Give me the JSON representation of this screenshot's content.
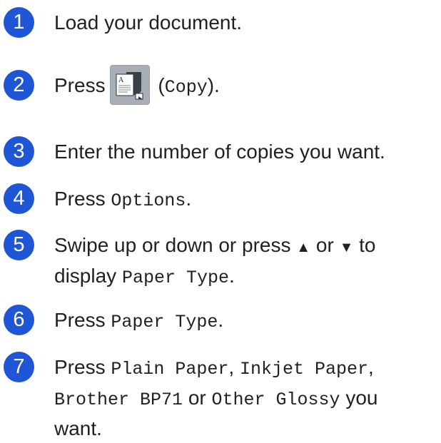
{
  "steps": [
    {
      "number": "1",
      "text": "Load your document."
    },
    {
      "number": "2",
      "press": "Press",
      "paren_open": " (",
      "copy_label": "Copy",
      "paren_close": ").",
      "icon": "copy-icon"
    },
    {
      "number": "3",
      "text": "Enter the number of copies you want."
    },
    {
      "number": "4",
      "press": "Press",
      "options": "Options",
      "end": "."
    },
    {
      "number": "5",
      "line1_a": "Swipe up or down or press",
      "up_arrow": "▲",
      "or": "or",
      "down_arrow": "▼",
      "line1_b": "to",
      "display": "display",
      "paper_type": "Paper Type",
      "end": "."
    },
    {
      "number": "6",
      "press": "Press",
      "paper_type": "Paper Type",
      "end": "."
    },
    {
      "number": "7",
      "press": "Press",
      "plain": "Plain Paper",
      "comma1": ",",
      "inkjet": "Inkjet Paper",
      "comma2": ",",
      "brother": "Brother BP71",
      "or": "or",
      "other": "Other Glossy",
      "you": "you",
      "want": "want."
    }
  ],
  "colors": {
    "step_badge": "#1e56d6",
    "text": "#231f20"
  }
}
